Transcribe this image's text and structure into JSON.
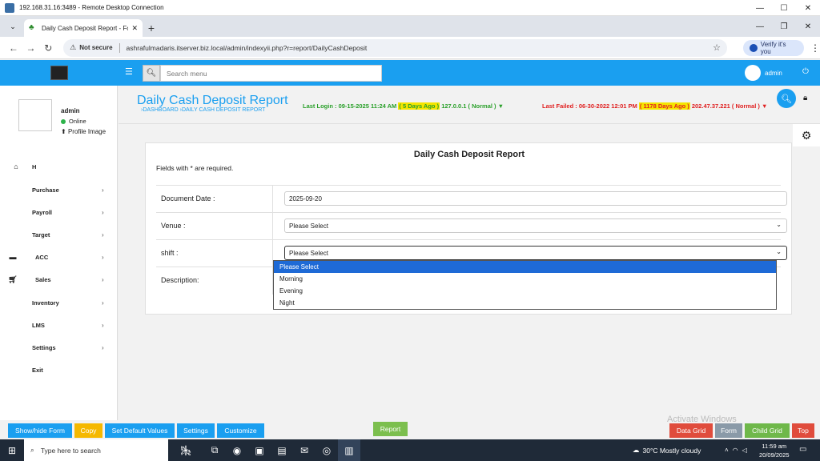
{
  "rdp": {
    "title": "192.168.31.16:3489 - Remote Desktop Connection"
  },
  "browser": {
    "tab_title": "Daily Cash Deposit Report - Fo",
    "not_secure": "Not secure",
    "url": "ashrafulmadaris.itserver.biz.local/admin/indexyii.php?r=report/DailyCashDeposit",
    "verify_label": "Verify it's you"
  },
  "header": {
    "search_placeholder": "Search menu",
    "user": "admin"
  },
  "sidebar": {
    "user": "admin",
    "status": "Online",
    "profile_link": "Profile Image",
    "items": [
      {
        "label": "H",
        "icon": "home-icon"
      },
      {
        "label": "Purchase"
      },
      {
        "label": "Payroll"
      },
      {
        "label": "Target"
      },
      {
        "label": "ACC",
        "icon": "bank-icon"
      },
      {
        "label": "Sales",
        "icon": "cart-icon"
      },
      {
        "label": "Inventory"
      },
      {
        "label": "LMS"
      },
      {
        "label": "Settings"
      },
      {
        "label": "Exit"
      }
    ]
  },
  "page": {
    "title": "Daily Cash Deposit Report",
    "breadcrumb": "›DASHBOARD ›DAILY CASH DEPOSIT REPORT",
    "last_login_prefix": "Last Login : 09-15-2025 11:24 AM",
    "last_login_highlight": "( 5 Days Ago )",
    "last_login_suffix": "127.0.0.1 ( Normal ) ▼",
    "last_failed_prefix": "Last Failed : 06-30-2022 12:01 PM",
    "last_failed_highlight": "( 1178 Days Ago )",
    "last_failed_suffix": "202.47.37.221 ( Normal ) ▼"
  },
  "form": {
    "title": "Daily Cash Deposit Report",
    "note": "Fields with * are required.",
    "document_date_label": "Document Date :",
    "document_date_value": "2025-09-20",
    "venue_label": "Venue :",
    "venue_value": "Please Select",
    "shift_label": "shift :",
    "shift_value": "Please Select",
    "description_label": "Description:",
    "shift_options": [
      "Please Select",
      "Morning",
      "Evening",
      "Night"
    ]
  },
  "bottom": {
    "show_hide_form": "Show/hide Form",
    "copy": "Copy",
    "set_default": "Set Default Values",
    "settings": "Settings",
    "customize": "Customize",
    "report": "Report",
    "data_grid": "Data Grid",
    "form": "Form",
    "child_grid": "Child Grid",
    "top": "Top",
    "activate_windows": "Activate Windows"
  },
  "taskbar": {
    "search": "Type here to search",
    "weather": "30°C  Mostly cloudy",
    "time": "11:59 am",
    "date": "20/09/2025"
  },
  "colors": {
    "accent": "#1a9ff0",
    "login_green": "#2aa02a",
    "failed_red": "#e02020",
    "highlight": "#f5e500"
  }
}
